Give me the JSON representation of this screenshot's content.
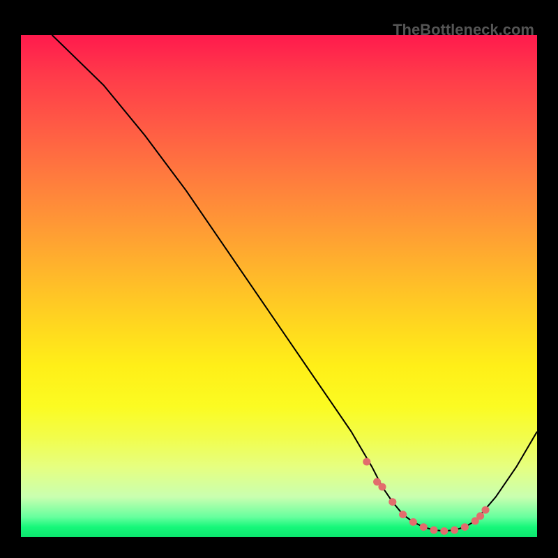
{
  "watermark": "TheBottleneck.com",
  "chart_data": {
    "type": "line",
    "title": "",
    "xlabel": "",
    "ylabel": "",
    "xlim": [
      0,
      100
    ],
    "ylim": [
      0,
      100
    ],
    "grid": false,
    "legend": false,
    "series": [
      {
        "name": "bottleneck-curve",
        "color": "#000000",
        "x": [
          6,
          10,
          16,
          24,
          32,
          40,
          48,
          56,
          60,
          64,
          68,
          70,
          72,
          74,
          76,
          78,
          80,
          82,
          84,
          86,
          88,
          92,
          96,
          100
        ],
        "values": [
          100,
          96,
          90,
          80,
          69,
          57,
          45,
          33,
          27,
          21,
          14,
          10,
          7,
          4.5,
          3,
          2,
          1.4,
          1.2,
          1.4,
          2,
          3.2,
          8,
          14,
          21
        ]
      }
    ],
    "markers": {
      "name": "highlight-dots",
      "color": "#e26d6d",
      "x": [
        67,
        69,
        70,
        72,
        74,
        76,
        78,
        80,
        82,
        84,
        86,
        88,
        89,
        90
      ],
      "values": [
        15,
        11,
        10,
        7,
        4.5,
        3,
        2,
        1.4,
        1.2,
        1.4,
        2,
        3.2,
        4.2,
        5.4
      ]
    }
  }
}
